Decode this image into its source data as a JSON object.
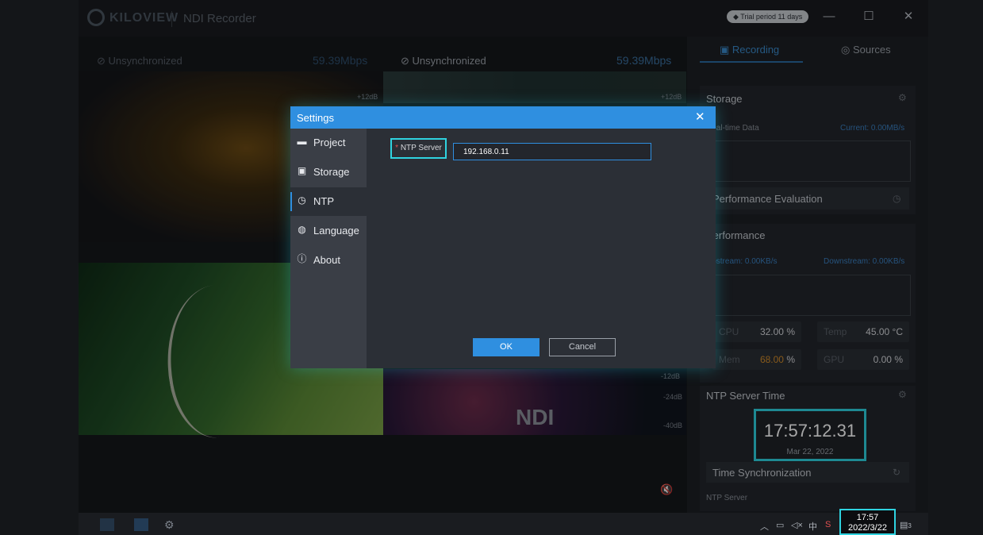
{
  "app": {
    "logo": "KILOVIEW",
    "title": "NDI Recorder",
    "trial_badge": "Trial period 11 days",
    "win_controls": {
      "minimize": "—",
      "maximize": "☐",
      "close": "✕"
    }
  },
  "video": {
    "tile1_status": "Unsynchronized",
    "tile1_rate": "59.39Mbps",
    "tile2_status": "Unsynchronized",
    "tile2_rate": "59.39Mbps",
    "db_plus12_a": "+12dB",
    "db_plus12_b": "+12dB",
    "db_minus12": "-12dB",
    "db_minus24": "-24dB",
    "db_minus40": "-40dB",
    "ndi_label": "NDI"
  },
  "right_panel": {
    "tabs": {
      "recording": "Recording",
      "sources": "Sources"
    },
    "storage": {
      "title": "Storage",
      "realtime_label": "Real-time Data",
      "current_label": "Current: 0.00MB/s",
      "perf_eval": "Performance Evaluation"
    },
    "performance": {
      "title": "Performance",
      "upstream": "Upstream: 0.00KB/s",
      "downstream": "Downstream: 0.00KB/s",
      "cpu_label": "CPU",
      "cpu_value": "32.00",
      "temp_label": "Temp",
      "temp_value": "45.00",
      "mem_label": "Mem",
      "mem_value": "68.00",
      "gpu_label": "GPU",
      "gpu_value": "0.00",
      "percent": "%",
      "celsius": "°C"
    },
    "ntp_time": {
      "title": "NTP Server Time",
      "time": "17:57:12.31",
      "date": "Mar 22, 2022",
      "sync_label": "Time Synchronization",
      "server_label": "NTP Server"
    }
  },
  "dialog": {
    "title": "Settings",
    "close": "✕",
    "nav": [
      {
        "label": "Project",
        "icon": "folder-icon"
      },
      {
        "label": "Storage",
        "icon": "storage-icon"
      },
      {
        "label": "NTP",
        "icon": "clock-icon"
      },
      {
        "label": "Language",
        "icon": "globe-icon"
      },
      {
        "label": "About",
        "icon": "info-icon"
      }
    ],
    "active_nav": "NTP",
    "ntp_required_mark": "*",
    "ntp_label": "NTP Server",
    "ntp_value": "192.168.0.11",
    "ok_label": "OK",
    "cancel_label": "Cancel"
  },
  "taskbar": {
    "clock_time": "17:57",
    "clock_date": "2022/3/22",
    "tray_ime": "中",
    "notification_count": "3"
  },
  "colors": {
    "accent": "#2f8fe0",
    "highlight": "#2fd3e0",
    "mem_value": "#d08a2a"
  }
}
